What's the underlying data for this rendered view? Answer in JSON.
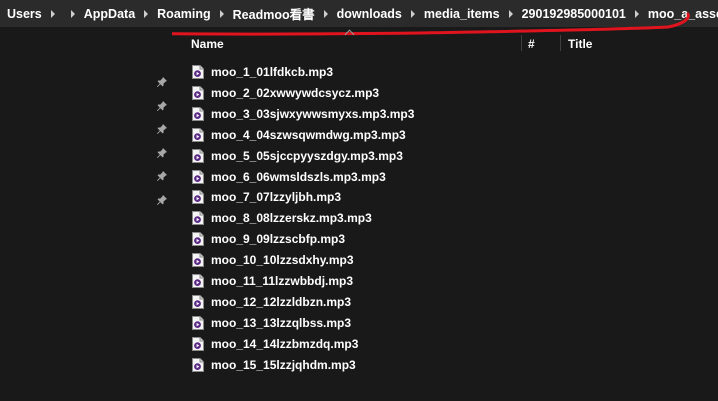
{
  "breadcrumb": {
    "items": [
      {
        "label": "Users"
      },
      {
        "label": "",
        "redacted": true
      },
      {
        "label": "AppData"
      },
      {
        "label": "Roaming"
      },
      {
        "label": "Readmoo看書"
      },
      {
        "label": "downloads"
      },
      {
        "label": "media_items"
      },
      {
        "label": "290192985000101"
      },
      {
        "label": "moo_a_asset"
      }
    ]
  },
  "columns": {
    "name": "Name",
    "number": "#",
    "title": "Title"
  },
  "nav": {
    "pinned_count": 6,
    "icon": "pin-icon"
  },
  "files": [
    {
      "name": "moo_1_01lfdkcb.mp3",
      "icon": "media-file-icon"
    },
    {
      "name": "moo_2_02xwwywdcsycz.mp3",
      "icon": "media-file-icon"
    },
    {
      "name": "moo_3_03sjwxywwsmyxs.mp3.mp3",
      "icon": "media-file-icon"
    },
    {
      "name": "moo_4_04szwsqwmdwg.mp3.mp3",
      "icon": "media-file-icon"
    },
    {
      "name": "moo_5_05sjccpyyszdgy.mp3.mp3",
      "icon": "media-file-icon"
    },
    {
      "name": "moo_6_06wmsldszls.mp3.mp3",
      "icon": "media-file-icon"
    },
    {
      "name": "moo_7_07lzzyljbh.mp3",
      "icon": "media-file-icon"
    },
    {
      "name": "moo_8_08lzzerskz.mp3.mp3",
      "icon": "media-file-icon"
    },
    {
      "name": "moo_9_09lzzscbfp.mp3",
      "icon": "media-file-icon"
    },
    {
      "name": "moo_10_10lzzsdxhy.mp3",
      "icon": "media-file-icon"
    },
    {
      "name": "moo_11_11lzzwbbdj.mp3",
      "icon": "media-file-icon"
    },
    {
      "name": "moo_12_12lzzldbzn.mp3",
      "icon": "media-file-icon"
    },
    {
      "name": "moo_13_13lzzqlbss.mp3",
      "icon": "media-file-icon"
    },
    {
      "name": "moo_14_14lzzbmzdq.mp3",
      "icon": "media-file-icon"
    },
    {
      "name": "moo_15_15lzzjqhdm.mp3",
      "icon": "media-file-icon"
    }
  ],
  "colors": {
    "background": "#191919",
    "addressbar": "#2b2b2b",
    "annotation": "#e0141e",
    "text": "#ffffff"
  }
}
